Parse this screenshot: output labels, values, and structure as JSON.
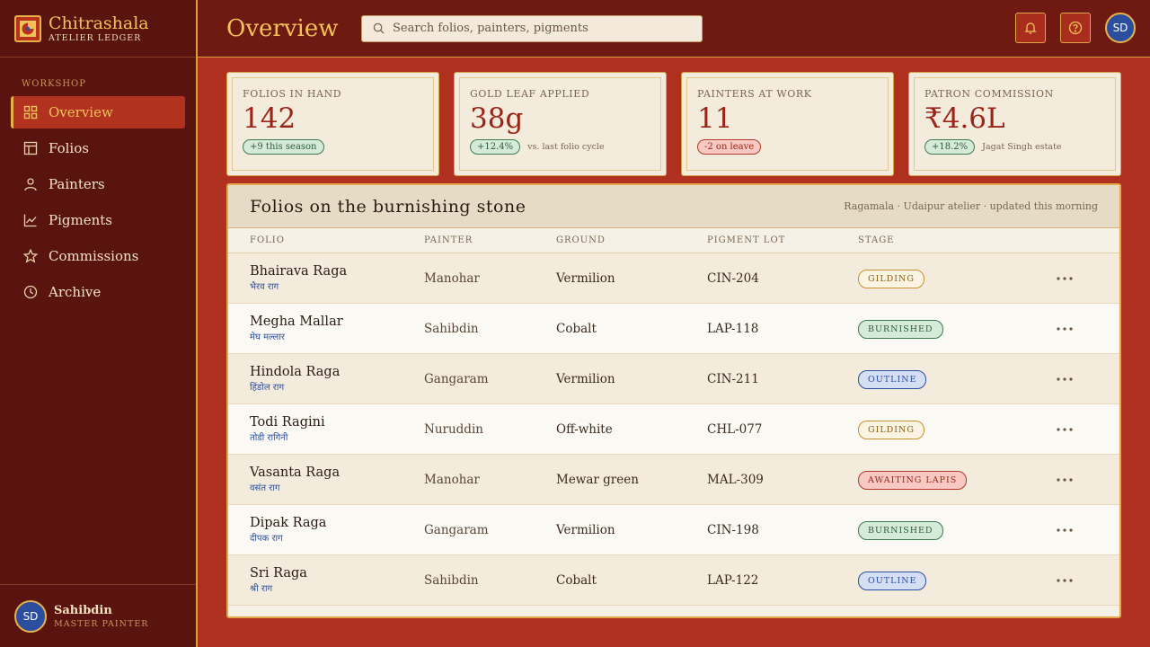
{
  "brand": {
    "name": "Chitrashala",
    "subtitle": "ATELIER LEDGER"
  },
  "sidebar": {
    "section": "WORKSHOP",
    "items": [
      {
        "label": "Overview",
        "icon": "grid-icon",
        "active": true
      },
      {
        "label": "Folios",
        "icon": "layout-icon"
      },
      {
        "label": "Painters",
        "icon": "user-icon"
      },
      {
        "label": "Pigments",
        "icon": "chart-icon"
      },
      {
        "label": "Commissions",
        "icon": "star-icon"
      },
      {
        "label": "Archive",
        "icon": "clock-icon"
      }
    ],
    "user": {
      "initials": "SD",
      "name": "Sahibdin",
      "role": "MASTER PAINTER"
    }
  },
  "header": {
    "title": "Overview",
    "search_placeholder": "Search folios, painters, pigments",
    "avatar_initials": "SD"
  },
  "kpis": [
    {
      "label": "FOLIOS IN HAND",
      "value": "142",
      "pill": "+9 this season",
      "pill_tone": "green",
      "note": ""
    },
    {
      "label": "GOLD LEAF APPLIED",
      "value": "38g",
      "pill": "+12.4%",
      "pill_tone": "green",
      "note": "vs. last folio cycle"
    },
    {
      "label": "PAINTERS AT WORK",
      "value": "11",
      "pill": "-2 on leave",
      "pill_tone": "red",
      "note": ""
    },
    {
      "label": "PATRON COMMISSION",
      "value": "₹4.6L",
      "pill": "+18.2%",
      "pill_tone": "green",
      "note": "Jagat Singh estate"
    }
  ],
  "table": {
    "title": "Folios on the burnishing stone",
    "meta": "Ragamala · Udaipur atelier · updated this morning",
    "columns": [
      "FOLIO",
      "PAINTER",
      "GROUND",
      "PIGMENT LOT",
      "STAGE"
    ],
    "rows": [
      {
        "folio": "Bhairava Raga",
        "devanagari": "भैरव राग",
        "painter": "Manohar",
        "ground": "Vermilion",
        "lot": "CIN-204",
        "stage": "GILDING",
        "tone": "gilding"
      },
      {
        "folio": "Megha Mallar",
        "devanagari": "मेघ मल्लार",
        "painter": "Sahibdin",
        "ground": "Cobalt",
        "lot": "LAP-118",
        "stage": "BURNISHED",
        "tone": "burnished"
      },
      {
        "folio": "Hindola Raga",
        "devanagari": "हिंडोल राग",
        "painter": "Gangaram",
        "ground": "Vermilion",
        "lot": "CIN-211",
        "stage": "OUTLINE",
        "tone": "outline"
      },
      {
        "folio": "Todi Ragini",
        "devanagari": "तोडी रागिनी",
        "painter": "Nuruddin",
        "ground": "Off-white",
        "lot": "CHL-077",
        "stage": "GILDING",
        "tone": "gilding"
      },
      {
        "folio": "Vasanta Raga",
        "devanagari": "वसंत राग",
        "painter": "Manohar",
        "ground": "Mewar green",
        "lot": "MAL-309",
        "stage": "AWAITING LAPIS",
        "tone": "awaiting"
      },
      {
        "folio": "Dipak Raga",
        "devanagari": "दीपक राग",
        "painter": "Gangaram",
        "ground": "Vermilion",
        "lot": "CIN-198",
        "stage": "BURNISHED",
        "tone": "burnished"
      },
      {
        "folio": "Sri Raga",
        "devanagari": "श्री राग",
        "painter": "Sahibdin",
        "ground": "Cobalt",
        "lot": "LAP-122",
        "stage": "OUTLINE",
        "tone": "outline"
      }
    ]
  },
  "colors": {
    "accent": "#f3c35a",
    "sidebar": "#5a1410",
    "header": "#6e1a12",
    "background": "#b0301f",
    "indigo": "#2b4e9e"
  }
}
